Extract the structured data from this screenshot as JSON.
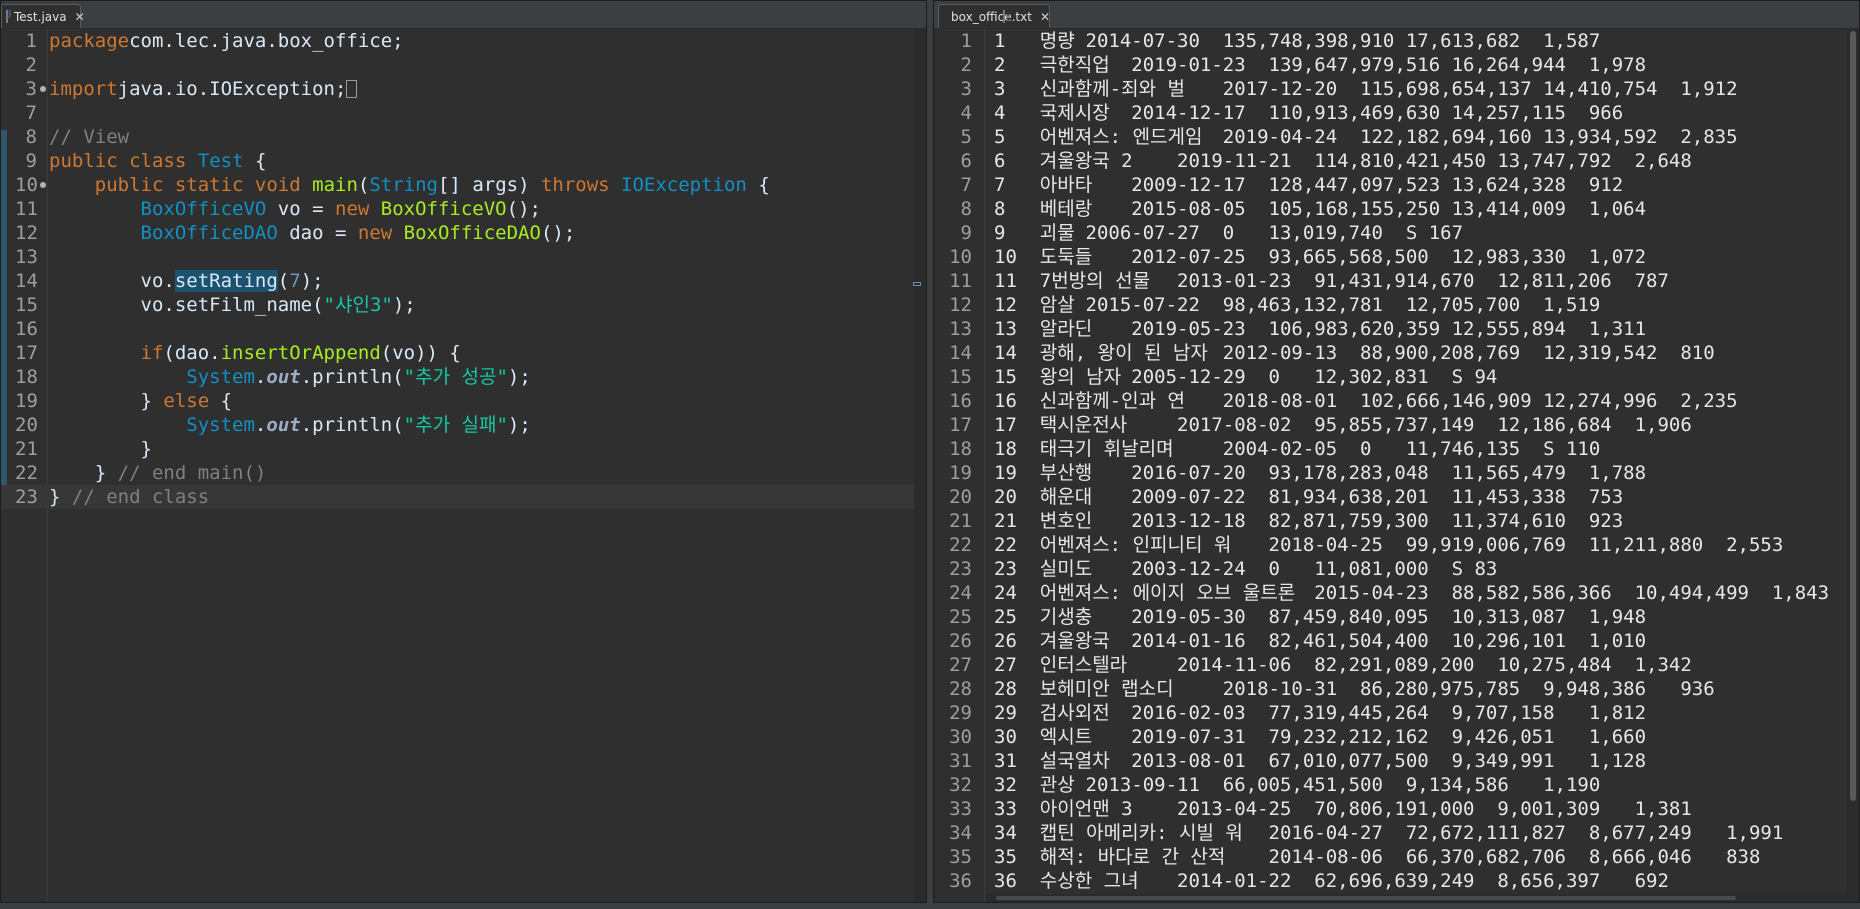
{
  "left_editor": {
    "tab_label": "Test.java",
    "lines": [
      {
        "n": "1",
        "code": [
          [
            "kw",
            "package"
          ],
          [
            "",
            "com.lec.java.box_office;"
          ]
        ]
      },
      {
        "n": "2",
        "code": []
      },
      {
        "n": "3",
        "code": [
          [
            "kw",
            "import"
          ],
          [
            "",
            "java.io.IOException;"
          ]
        ]
      },
      {
        "n": "7",
        "code": []
      },
      {
        "n": "8",
        "code": [
          [
            "cm",
            "// View"
          ]
        ]
      },
      {
        "n": "9",
        "code": [
          [
            "kw",
            "public"
          ],
          [
            "",
            ""
          ],
          [
            "kw",
            "class"
          ],
          [
            "",
            ""
          ],
          [
            "ty",
            "Test"
          ],
          [
            "",
            " {"
          ]
        ]
      },
      {
        "n": "10",
        "code": [
          [
            "",
            "    "
          ],
          [
            "kw",
            "public static void"
          ],
          [
            "",
            ""
          ],
          [
            "fn",
            "main"
          ],
          [
            "",
            "("
          ],
          [
            "ty",
            "String"
          ],
          [
            "",
            "[] "
          ],
          [
            "",
            "args) "
          ],
          [
            "kw",
            "throws"
          ],
          [
            "",
            ""
          ],
          [
            "ty",
            "IOException"
          ],
          [
            "",
            " {"
          ]
        ]
      },
      {
        "n": "11",
        "code": [
          [
            "",
            "        "
          ],
          [
            "ty",
            "BoxOfficeVO"
          ],
          [
            "",
            " vo = "
          ],
          [
            "kw",
            "new"
          ],
          [
            "",
            ""
          ],
          [
            "fn",
            "BoxOfficeVO"
          ],
          [
            "",
            "();"
          ]
        ]
      },
      {
        "n": "12",
        "code": [
          [
            "",
            "        "
          ],
          [
            "ty",
            "BoxOfficeDAO"
          ],
          [
            "",
            " dao = "
          ],
          [
            "kw",
            "new"
          ],
          [
            "",
            ""
          ],
          [
            "fn",
            "BoxOfficeDAO"
          ],
          [
            "",
            "();"
          ]
        ]
      },
      {
        "n": "13",
        "code": []
      },
      {
        "n": "14",
        "code": [
          [
            "",
            "        vo."
          ],
          [
            "hl",
            "setRating"
          ],
          [
            "",
            "("
          ],
          [
            "nm",
            "7"
          ],
          [
            "",
            ");"
          ]
        ]
      },
      {
        "n": "15",
        "code": [
          [
            "",
            "        vo.setFilm_name("
          ],
          [
            "st",
            "\"샤인3\""
          ],
          [
            "",
            ");"
          ]
        ]
      },
      {
        "n": "16",
        "code": []
      },
      {
        "n": "17",
        "code": [
          [
            "",
            "        "
          ],
          [
            "kw",
            "if"
          ],
          [
            "",
            "(dao."
          ],
          [
            "fn",
            "insertOrAppend"
          ],
          [
            "",
            "(vo)) {"
          ]
        ]
      },
      {
        "n": "18",
        "code": [
          [
            "",
            "            "
          ],
          [
            "ty",
            "System"
          ],
          [
            "",
            "."
          ],
          [
            "fd",
            "out"
          ],
          [
            "",
            ".println("
          ],
          [
            "st",
            "\"추가 성공\""
          ],
          [
            "",
            ");"
          ]
        ]
      },
      {
        "n": "19",
        "code": [
          [
            "",
            "        } "
          ],
          [
            "kw",
            "else"
          ],
          [
            "",
            " {"
          ]
        ]
      },
      {
        "n": "20",
        "code": [
          [
            "",
            "            "
          ],
          [
            "ty",
            "System"
          ],
          [
            "",
            "."
          ],
          [
            "fd",
            "out"
          ],
          [
            "",
            ".println("
          ],
          [
            "st",
            "\"추가 실패\""
          ],
          [
            "",
            ");"
          ]
        ]
      },
      {
        "n": "21",
        "code": [
          [
            "",
            "        }"
          ]
        ]
      },
      {
        "n": "22",
        "code": [
          [
            "",
            "    } "
          ],
          [
            "cm",
            "// end main()"
          ]
        ]
      },
      {
        "n": "23",
        "code": [
          [
            "",
            "} "
          ],
          [
            "cm",
            "// end class"
          ]
        ]
      }
    ]
  },
  "right_editor": {
    "tab_label": "box_office.txt",
    "rows": [
      "1\t명량\t2014-07-30\t135,748,398,910\t17,613,682\t1,587",
      "2\t극한직업\t2019-01-23\t139,647,979,516\t16,264,944\t1,978",
      "3\t신과함께-죄와 벌\t2017-12-20\t115,698,654,137\t14,410,754\t1,912",
      "4\t국제시장\t2014-12-17\t110,913,469,630\t14,257,115\t966",
      "5\t어벤져스: 엔드게임\t2019-04-24\t122,182,694,160\t13,934,592\t2,835",
      "6\t겨울왕국 2\t2019-11-21\t114,810,421,450\t13,747,792\t2,648",
      "7\t아바타\t2009-12-17\t128,447,097,523\t13,624,328\t912",
      "8\t베테랑\t2015-08-05\t105,168,155,250\t13,414,009\t1,064",
      "9\t괴물\t2006-07-27\t0\t13,019,740\tS 167",
      "10\t도둑들\t2012-07-25\t93,665,568,500\t12,983,330\t1,072",
      "11\t7번방의 선물\t2013-01-23\t91,431,914,670\t12,811,206\t787",
      "12\t암살\t2015-07-22\t98,463,132,781\t12,705,700\t1,519",
      "13\t알라딘\t2019-05-23\t106,983,620,359\t12,555,894\t1,311",
      "14\t광해, 왕이 된 남자\t2012-09-13\t88,900,208,769\t12,319,542\t810",
      "15\t왕의 남자\t2005-12-29\t0\t12,302,831\tS 94",
      "16\t신과함께-인과 연\t2018-08-01\t102,666,146,909\t12,274,996\t2,235",
      "17\t택시운전사\t2017-08-02\t95,855,737,149\t12,186,684\t1,906",
      "18\t태극기 휘날리며\t2004-02-05\t0\t11,746,135\tS 110",
      "19\t부산행\t2016-07-20\t93,178,283,048\t11,565,479\t1,788",
      "20\t해운대\t2009-07-22\t81,934,638,201\t11,453,338\t753",
      "21\t변호인\t2013-12-18\t82,871,759,300\t11,374,610\t923",
      "22\t어벤져스: 인피니티 워\t2018-04-25\t99,919,006,769\t11,211,880\t2,553",
      "23\t실미도\t2003-12-24\t0\t11,081,000\tS 83",
      "24\t어벤져스: 에이지 오브 울트론\t2015-04-23\t88,582,586,366\t10,494,499\t1,843",
      "25\t기생충\t2019-05-30\t87,459,840,095\t10,313,087\t1,948",
      "26\t겨울왕국\t2014-01-16\t82,461,504,400\t10,296,101\t1,010",
      "27\t인터스텔라\t2014-11-06\t82,291,089,200\t10,275,484\t1,342",
      "28\t보헤미안 랩소디\t2018-10-31\t86,280,975,785\t9,948,386\t936",
      "29\t검사외전\t2016-02-03\t77,319,445,264\t9,707,158\t1,812",
      "30\t엑시트\t2019-07-31\t79,232,212,162\t9,426,051\t1,660",
      "31\t설국열차\t2013-08-01\t67,010,077,500\t9,349,991\t1,128",
      "32\t관상\t2013-09-11\t66,005,451,500\t9,134,586\t1,190",
      "33\t아이언맨 3\t2013-04-25\t70,806,191,000\t9,001,309\t1,381",
      "34\t캡틴 아메리카: 시빌 워\t2016-04-27\t72,672,111,827\t8,677,249\t1,991",
      "35\t해적: 바다로 간 산적\t2014-08-06\t66,370,682,706\t8,666,046\t838",
      "36\t수상한 그녀\t2014-01-22\t62,696,639,249\t8,656,397\t692"
    ]
  }
}
